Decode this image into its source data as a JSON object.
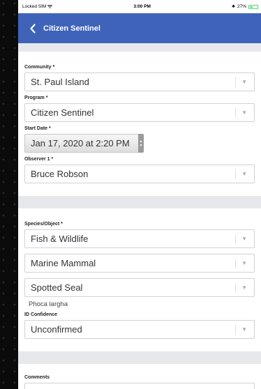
{
  "status_bar": {
    "carrier": "Locked SIM",
    "time": "3:00 PM",
    "battery": "27%"
  },
  "nav": {
    "title": "Citizen Sentinel"
  },
  "section1": {
    "community_label": "Community *",
    "community_value": "St. Paul Island",
    "program_label": "Program *",
    "program_value": "Citizen Sentinel",
    "start_date_label": "Start Date *",
    "start_date_value": "Jan 17, 2020 at 2:20 PM",
    "observer_label": "Observer 1 *",
    "observer_value": "Bruce Robson"
  },
  "section2": {
    "species_label": "Species/Object *",
    "species_level1": "Fish & Wildlife",
    "species_level2": "Marine Mammal",
    "species_level3": "Spotted Seal",
    "scientific_name": "Phoca largha",
    "confidence_label": "ID Confidence",
    "confidence_value": "Unconfirmed"
  },
  "section3": {
    "comments_label": "Comments",
    "comments_value": ""
  },
  "icons": {
    "caret": "▼",
    "stepper": "▲▼"
  },
  "colors": {
    "nav_bg": "#3f63b9",
    "page_bg": "#e6e8eb",
    "battery": "#4cd964"
  }
}
